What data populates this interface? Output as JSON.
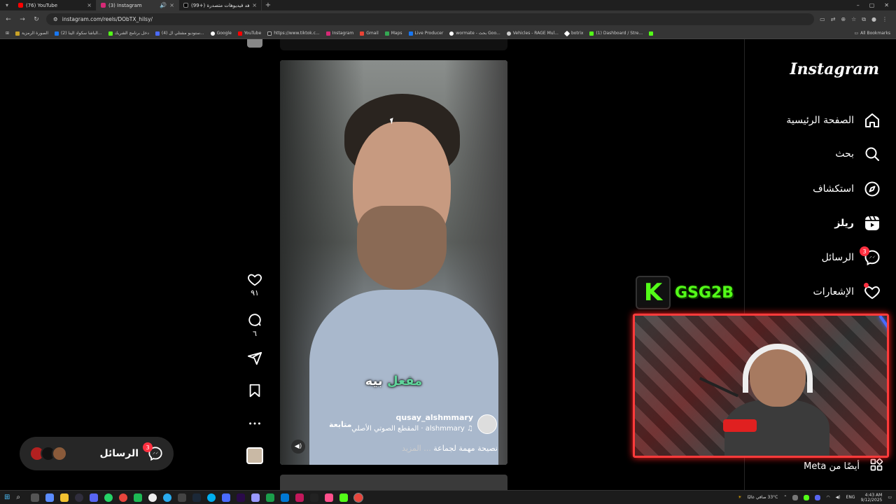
{
  "browser": {
    "tabs": [
      {
        "title": "(76) YouTube",
        "fav_color": "#ff0000",
        "active": false
      },
      {
        "title": "(3) Instagram",
        "fav_color": "#d62976",
        "active": true,
        "audio": "🔊"
      },
      {
        "title": "(99+) شاهد فيديوهات متصدرة |",
        "fav_color": "#000000",
        "active": false
      }
    ],
    "url": "instagram.com/reels/DObTX_hilsy/",
    "bookmarks": [
      "الصورة الرمزية",
      "(2) الباشا سكواد الينا...",
      "دخل برنامج الشريك",
      "(4) ستوديو مشتلي ال...",
      "Google",
      "YouTube",
      "https://www.tiktok.c...",
      "Instagram",
      "Gmail",
      "Maps",
      "Live Producer",
      "wormate - بحث Goo...",
      "Vehicles - RAGE Mul...",
      "botrix",
      "(1) Dashboard / Stre..."
    ],
    "all_bookmarks": "All Bookmarks"
  },
  "sidebar": {
    "logo": "Instagram",
    "items": [
      {
        "label": "الصفحة الرئيسية",
        "icon": "home-icon"
      },
      {
        "label": "بحث",
        "icon": "search-icon"
      },
      {
        "label": "استكشاف",
        "icon": "compass-icon"
      },
      {
        "label": "ريلز",
        "icon": "reels-icon"
      },
      {
        "label": "الرسائل",
        "icon": "messenger-icon",
        "badge": "3"
      },
      {
        "label": "الإشعارات",
        "icon": "heart-icon",
        "dot": true
      }
    ],
    "meta_label": "أيضًا من Meta"
  },
  "reel": {
    "caption_normal": "بيه",
    "caption_highlight": "مفعل",
    "username": "qusay_alshmmary",
    "follow": "متابعة",
    "audio": "alshmmary · المقطع الصوتي الأصلي",
    "description": "نصيحة مهمة لجماعة",
    "more": "... المزيد"
  },
  "actions": {
    "likes": "٩١",
    "comments": "٦"
  },
  "messages_pill": {
    "label": "الرسائل",
    "badge": "3"
  },
  "stream": {
    "kick_letter": "K",
    "channel": "GSG2B",
    "accent": "#53fc18"
  },
  "taskbar": {
    "weather": "33°C صافي غالبًا",
    "lang": "ENG",
    "time": "4:43 AM",
    "date": "9/12/2025"
  }
}
